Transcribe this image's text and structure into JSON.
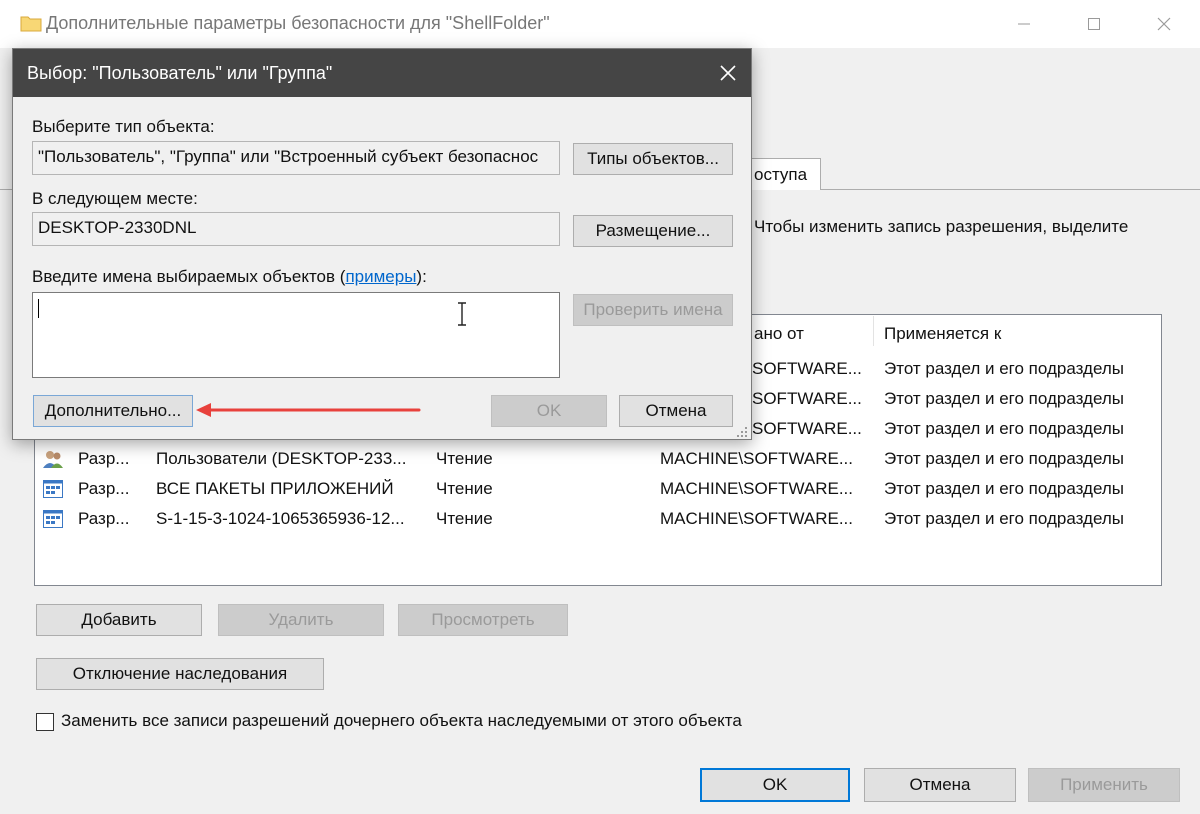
{
  "background_window": {
    "title": "Дополнительные параметры безопасности  для \"ShellFolder\"",
    "tab_partial": "оступа",
    "hint_partial": "Чтобы изменить запись разрешения, выделите",
    "columns": {
      "inherited_from": "ано от",
      "applies_to": "Применяется к"
    },
    "rows": [
      {
        "type": "",
        "principal": "",
        "access": "",
        "inherited": "SOFTWARE...",
        "applies": "Этот раздел и его подразделы",
        "icon": "none"
      },
      {
        "type": "",
        "principal": "",
        "access": "",
        "inherited": "SOFTWARE...",
        "applies": "Этот раздел и его подразделы",
        "icon": "none"
      },
      {
        "type": "",
        "principal": "",
        "access": "",
        "inherited": "SOFTWARE...",
        "applies": "Этот раздел и его подразделы",
        "icon": "none"
      },
      {
        "type": "Разр...",
        "principal": "Пользователи (DESKTOP-233...",
        "access": "Чтение",
        "inherited": "MACHINE\\SOFTWARE...",
        "applies": "Этот раздел и его подразделы",
        "icon": "users-group-icon"
      },
      {
        "type": "Разр...",
        "principal": "ВСЕ ПАКЕТЫ ПРИЛОЖЕНИЙ",
        "access": "Чтение",
        "inherited": "MACHINE\\SOFTWARE...",
        "applies": "Этот раздел и его подразделы",
        "icon": "app-package-icon"
      },
      {
        "type": "Разр...",
        "principal": "S-1-15-3-1024-1065365936-12...",
        "access": "Чтение",
        "inherited": "MACHINE\\SOFTWARE...",
        "applies": "Этот раздел и его подразделы",
        "icon": "app-package-icon"
      }
    ],
    "buttons": {
      "add": "Добавить",
      "remove": "Удалить",
      "view": "Просмотреть",
      "disable_inheritance": "Отключение наследования",
      "ok": "OK",
      "cancel": "Отмена",
      "apply": "Применить"
    },
    "replace_checkbox_label": "Заменить все записи разрешений дочернего объекта наследуемыми от этого объекта",
    "replace_checked": false
  },
  "dialog": {
    "title": "Выбор: \"Пользователь\" или \"Группа\"",
    "object_type_label": "Выберите тип объекта:",
    "object_type_value": "\"Пользователь\", \"Группа\" или \"Встроенный субъект безопаснос",
    "object_types_button": "Типы объектов...",
    "location_label": "В следующем месте:",
    "location_value": "DESKTOP-2330DNL",
    "locations_button": "Размещение...",
    "names_label_prefix": "Введите имена выбираемых объектов (",
    "names_label_link": "примеры",
    "names_label_suffix": "):",
    "names_value": "",
    "check_names_button": "Проверить имена",
    "advanced_button": "Дополнительно...",
    "ok_button": "OK",
    "cancel_button": "Отмена"
  },
  "colors": {
    "dialog_title_bg": "#454545",
    "link": "#0066cc",
    "arrow": "#e8413c",
    "primary_border": "#0078d7"
  }
}
